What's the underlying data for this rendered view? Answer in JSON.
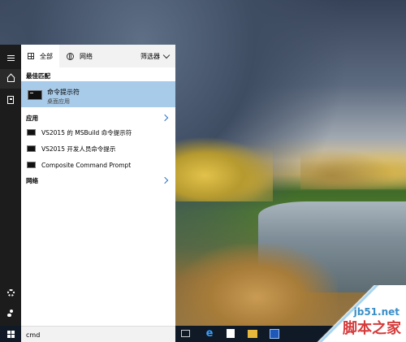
{
  "start_menu": {
    "tabs": [
      {
        "label": "全部",
        "icon": "grid-icon",
        "active": true
      },
      {
        "label": "网络",
        "icon": "globe-icon",
        "active": false
      }
    ],
    "filter_label": "筛选器",
    "best_match": {
      "header": "最佳匹配",
      "title": "命令提示符",
      "subtitle": "桌面应用"
    },
    "apps": {
      "header": "应用",
      "items": [
        "VS2015 的 MSBuild 命令提示符",
        "VS2015 开发人员命令提示",
        "Composite Command Prompt"
      ]
    },
    "web": {
      "header": "网络"
    }
  },
  "search": {
    "value": "cmd"
  },
  "rail": {
    "items": [
      "hamburger-icon",
      "home-icon",
      "notebook-icon",
      "gear-icon",
      "feedback-icon"
    ]
  },
  "taskbar": {
    "icons": [
      "windows-logo-icon",
      "task-view-icon",
      "edge-icon",
      "store-icon",
      "file-explorer-icon",
      "app-icon"
    ]
  },
  "watermark": {
    "site": "jb51.net",
    "name": "脚本之家"
  },
  "colors": {
    "highlight": "#a8cbe9",
    "accent": "#2a78c6",
    "rail_bg": "#1c1c1c",
    "taskbar_bg": "#0f1a26"
  }
}
